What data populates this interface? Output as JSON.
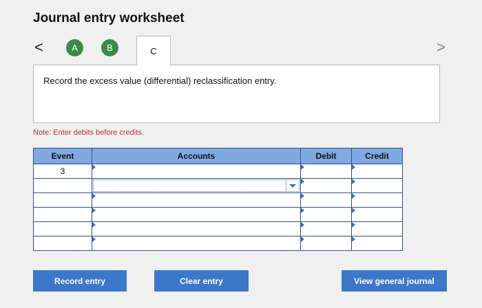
{
  "header": {
    "title": "Journal entry worksheet",
    "prev_symbol": "<",
    "next_symbol": ">"
  },
  "tabs": [
    {
      "label": "A",
      "completed": true
    },
    {
      "label": "B",
      "completed": true
    },
    {
      "label": "C",
      "active": true
    }
  ],
  "prompt": {
    "text": "Record the excess value (differential) reclassification entry."
  },
  "note": "Note: Enter debits before credits.",
  "table": {
    "headers": [
      "Event",
      "Accounts",
      "Debit",
      "Credit"
    ],
    "rows": [
      {
        "event": "3",
        "account": "",
        "debit": "",
        "credit": ""
      },
      {
        "event": "",
        "account": "",
        "debit": "",
        "credit": ""
      },
      {
        "event": "",
        "account": "",
        "debit": "",
        "credit": ""
      },
      {
        "event": "",
        "account": "",
        "debit": "",
        "credit": ""
      },
      {
        "event": "",
        "account": "",
        "debit": "",
        "credit": ""
      },
      {
        "event": "",
        "account": "",
        "debit": "",
        "credit": ""
      }
    ]
  },
  "buttons": {
    "record": "Record entry",
    "clear": "Clear entry",
    "view": "View general journal"
  },
  "colors": {
    "tab_done": "#3a8a4a",
    "header_bg": "#7fa9e0",
    "button_bg": "#3b78c9",
    "note": "#b33333"
  }
}
